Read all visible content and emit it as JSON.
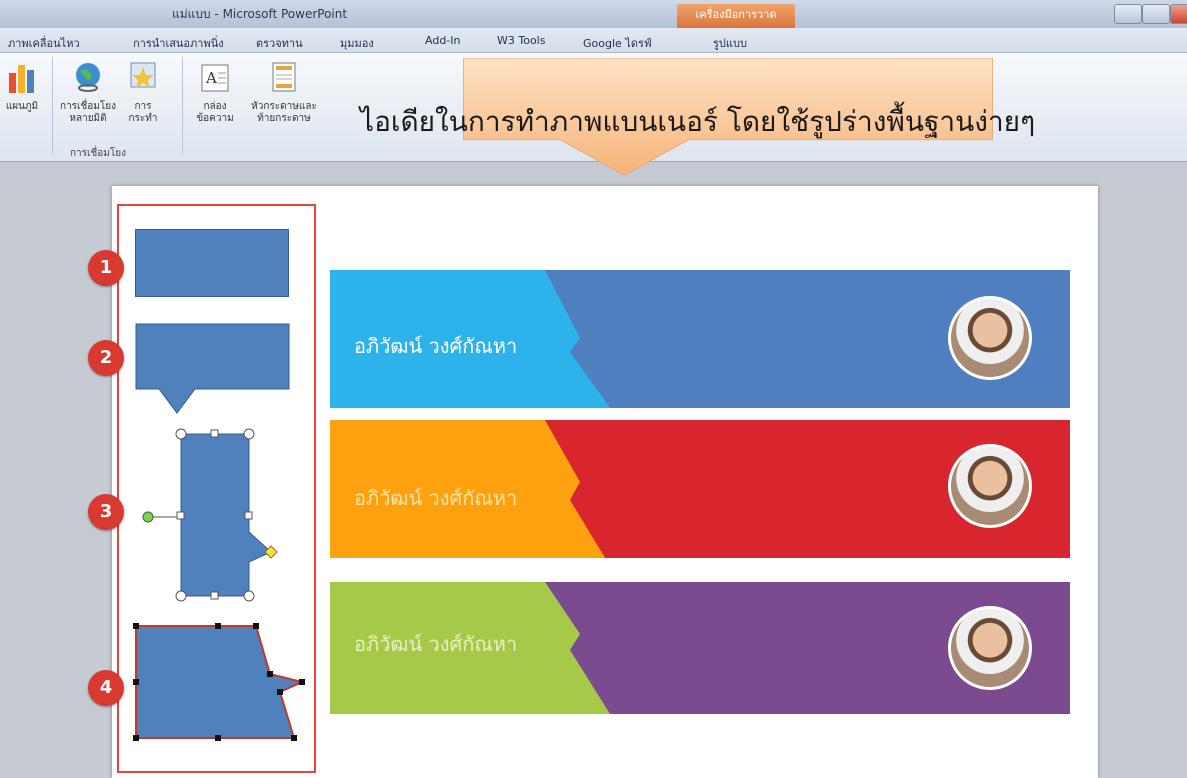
{
  "window": {
    "title": "แม่แบบ - Microsoft PowerPoint",
    "contextual_tab": "เครื่องมือการวาด"
  },
  "tabs": [
    "ภาพเคลื่อนไหว",
    "การนำเสนอภาพนิ่ง",
    "ตรวจทาน",
    "มุมมอง",
    "Add-In",
    "W3 Tools",
    "Google ไดรฟ์",
    "รูปแบบ"
  ],
  "ribbon": {
    "chart_label": "แผนภูมิ",
    "hyperlink_label": "การเชื่อมโยง หลายมิติ",
    "action_label": "การ กระทำ",
    "group_links": "การเชื่อมโยง",
    "textbox_label": "กล่อง ข้อความ",
    "header_footer_label": "หัวกระดาษและ ท้ายกระดาษ"
  },
  "callout": {
    "text": "ไอเดียในการทำภาพแบนเนอร์ โดยใช้รูปร่างพื้นฐานง่ายๆ"
  },
  "steps": [
    "1",
    "2",
    "3",
    "4"
  ],
  "banners": [
    {
      "name": "อภิวัฒน์ วงศ์กัณหา",
      "left_color": "#2db2ec",
      "right_color": "#4f7fbf",
      "text_color": "#ffffff"
    },
    {
      "name": "อภิวัฒน์ วงศ์กัณหา",
      "left_color": "#fda10f",
      "right_color": "#d9262e",
      "text_color": "#ffe2a8"
    },
    {
      "name": "อภิวัฒน์ วงศ์กัณหา",
      "left_color": "#a7c94a",
      "right_color": "#7b4a8f",
      "text_color": "#e8f0c0"
    }
  ],
  "colors": {
    "shape_fill": "#4f81bd",
    "step_badge": "#d93a2f",
    "callout_fill": "#fbd0a6"
  }
}
